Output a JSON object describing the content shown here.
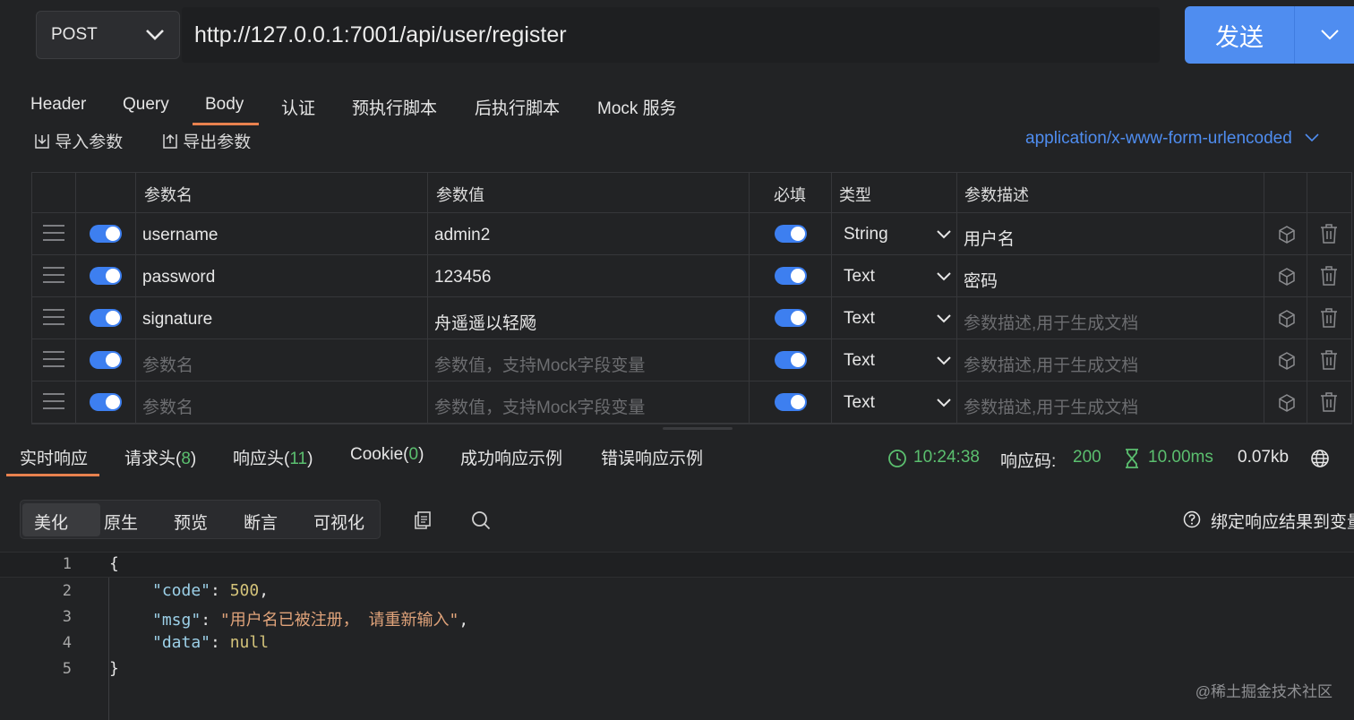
{
  "request": {
    "method": "POST",
    "url": "http://127.0.0.1:7001/api/user/register",
    "send_label": "发送"
  },
  "request_tabs": [
    "Header",
    "Query",
    "Body",
    "认证",
    "预执行脚本",
    "后执行脚本",
    "Mock 服务"
  ],
  "active_request_tab": "Body",
  "body_toolbar": {
    "import_label": "导入参数",
    "export_label": "导出参数",
    "content_type": "application/x-www-form-urlencoded"
  },
  "params_table": {
    "headers": {
      "name": "参数名",
      "value": "参数值",
      "required": "必填",
      "type": "类型",
      "description": "参数描述"
    },
    "rows": [
      {
        "enabled": true,
        "name": "username",
        "value": "admin2",
        "required": true,
        "type": "String",
        "description": "用户名"
      },
      {
        "enabled": true,
        "name": "password",
        "value": "123456",
        "required": true,
        "type": "Text",
        "description": "密码"
      },
      {
        "enabled": true,
        "name": "signature",
        "value": "舟遥遥以轻飏",
        "required": true,
        "type": "Text",
        "description": ""
      },
      {
        "enabled": true,
        "name": "",
        "value": "",
        "required": true,
        "type": "Text",
        "description": ""
      },
      {
        "enabled": true,
        "name": "",
        "value": "",
        "required": true,
        "type": "Text",
        "description": ""
      }
    ],
    "placeholders": {
      "name": "参数名",
      "value": "参数值，支持Mock字段变量",
      "description": "参数描述,用于生成文档"
    }
  },
  "response_tabs": {
    "realtime": "实时响应",
    "req_headers": "请求头(",
    "req_headers_count": "8",
    "resp_headers": "响应头(",
    "resp_headers_count": "11",
    "cookie": "Cookie(",
    "cookie_count": "0",
    "close_paren": ")",
    "success_example": "成功响应示例",
    "error_example": "错误响应示例"
  },
  "response_status": {
    "time": "10:24:38",
    "code_label": "响应码:",
    "code": "200",
    "duration": "10.00ms",
    "size": "0.07kb"
  },
  "view_modes": [
    "美化",
    "原生",
    "预览",
    "断言",
    "可视化"
  ],
  "active_view_mode": "美化",
  "bind_label": "绑定响应结果到变量",
  "response_body": {
    "line_numbers": [
      "1",
      "2",
      "3",
      "4",
      "5"
    ],
    "code_key": "\"code\"",
    "code_value": "500",
    "msg_key": "\"msg\"",
    "msg_value": "\"用户名已被注册， 请重新输入\"",
    "data_key": "\"data\"",
    "data_value": "null"
  },
  "watermark": "@稀土掘金技术社区",
  "colors": {
    "accent_blue": "#4f8df0",
    "active_tab_underline": "#e8814e",
    "success_green": "#5bbf6f",
    "background": "#222325"
  }
}
